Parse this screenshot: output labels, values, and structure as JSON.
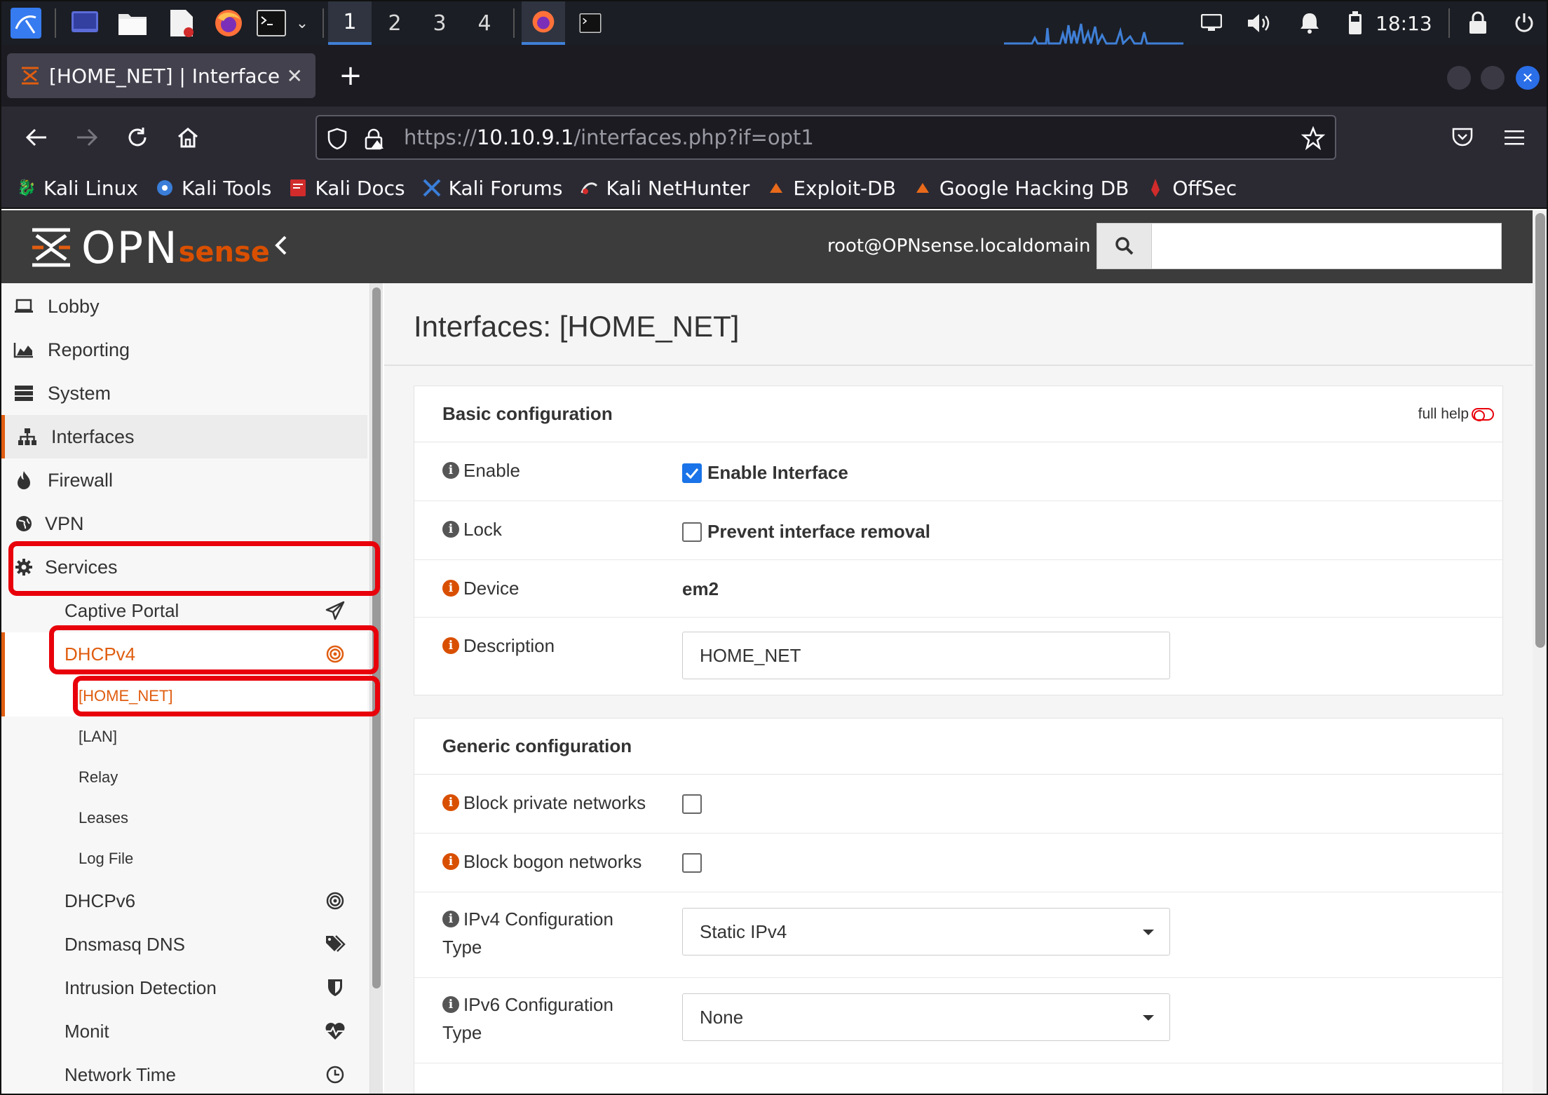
{
  "taskbar": {
    "workspaces": [
      "1",
      "2",
      "3",
      "4"
    ],
    "active_workspace": "1",
    "clock": "18:13",
    "icons": [
      "kali-menu-icon",
      "desktop-icon",
      "file-manager-icon",
      "text-editor-icon",
      "firefox-icon",
      "terminal-icon",
      "dropdown-icon",
      "network-icon",
      "volume-icon",
      "notification-icon",
      "battery-icon",
      "lock-icon",
      "power-icon"
    ]
  },
  "browser": {
    "tab_title": "[HOME_NET] | Interfaces",
    "url_prefix": "https://",
    "url_host": "10.10.9.1",
    "url_path": "/interfaces.php?if=opt1",
    "bookmarks": [
      "Kali Linux",
      "Kali Tools",
      "Kali Docs",
      "Kali Forums",
      "Kali NetHunter",
      "Exploit-DB",
      "Google Hacking DB",
      "OffSec"
    ]
  },
  "header": {
    "logo_main": "OPN",
    "logo_sub": "sense",
    "user": "root@OPNsense.localdomain",
    "search_placeholder": ""
  },
  "sidebar": {
    "items": [
      {
        "label": "Lobby",
        "icon": "laptop-icon"
      },
      {
        "label": "Reporting",
        "icon": "area-chart-icon"
      },
      {
        "label": "System",
        "icon": "server-icon"
      },
      {
        "label": "Interfaces",
        "icon": "sitemap-icon"
      },
      {
        "label": "Firewall",
        "icon": "fire-icon"
      },
      {
        "label": "VPN",
        "icon": "globe-icon"
      },
      {
        "label": "Services",
        "icon": "cog-icon"
      }
    ],
    "services": [
      {
        "label": "Captive Portal",
        "icon": "paper-plane-icon"
      },
      {
        "label": "DHCPv4",
        "icon": "bullseye-icon"
      }
    ],
    "dhcpv4_children": [
      "[HOME_NET]",
      "[LAN]",
      "Relay",
      "Leases",
      "Log File"
    ],
    "services_more": [
      {
        "label": "DHCPv6",
        "icon": "bullseye-icon"
      },
      {
        "label": "Dnsmasq DNS",
        "icon": "tags-icon"
      },
      {
        "label": "Intrusion Detection",
        "icon": "shield-icon"
      },
      {
        "label": "Monit",
        "icon": "heartbeat-icon"
      },
      {
        "label": "Network Time",
        "icon": "clock-icon"
      }
    ]
  },
  "main": {
    "title": "Interfaces: [HOME_NET]",
    "full_help": "full help",
    "basic": {
      "heading": "Basic configuration",
      "enable_label": "Enable",
      "enable_text": "Enable Interface",
      "enable_checked": true,
      "lock_label": "Lock",
      "lock_text": "Prevent interface removal",
      "lock_checked": false,
      "device_label": "Device",
      "device_value": "em2",
      "description_label": "Description",
      "description_value": "HOME_NET"
    },
    "generic": {
      "heading": "Generic configuration",
      "block_private_label": "Block private networks",
      "block_private_checked": false,
      "block_bogon_label": "Block bogon networks",
      "block_bogon_checked": false,
      "ipv4_label_1": "IPv4 Configuration",
      "ipv4_label_2": "Type",
      "ipv4_value": "Static IPv4",
      "ipv6_label_1": "IPv6 Configuration",
      "ipv6_label_2": "Type",
      "ipv6_value": "None"
    }
  },
  "colors": {
    "accent": "#e05d10",
    "highlight_box": "#e8000b",
    "header_bg": "#3c3c3c",
    "checkbox_on": "#1a73e8"
  }
}
